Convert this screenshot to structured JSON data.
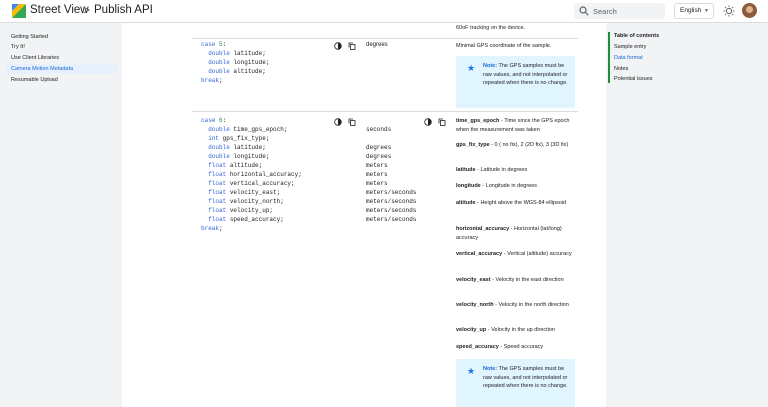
{
  "header": {
    "brand": "Street View",
    "breadcrumb_separator": ">",
    "page": "Publish API",
    "search_placeholder": "Search",
    "language": "English",
    "icons": [
      "street-view-logo-icon",
      "search-icon",
      "brightness-icon",
      "avatar"
    ]
  },
  "sidebar": {
    "items": [
      {
        "label": "Getting Started",
        "active": false
      },
      {
        "label": "Try It!",
        "active": false
      },
      {
        "label": "Use Client Libraries",
        "active": false
      },
      {
        "label": "Camera Motion Metadata",
        "active": true
      },
      {
        "label": "Resumable Upload",
        "active": false
      }
    ]
  },
  "toc": {
    "title": "Table of contents",
    "items": [
      {
        "label": "Sample entry",
        "active": false
      },
      {
        "label": "Data format",
        "active": true
      },
      {
        "label": "Notes",
        "active": false
      },
      {
        "label": "Potential issues",
        "active": false
      }
    ]
  },
  "main": {
    "top_text": "60oF tracking on the device.",
    "case5": {
      "code": [
        "case 5:",
        "  double latitude;",
        "  double longitude;",
        "  double altitude;",
        "break;"
      ],
      "unit": "degrees",
      "desc": "Minimal GPS coordinate of the sample.",
      "note_label": "Note:",
      "note_text": "The GPS samples must be raw values, and not interpolated or repeated when there is no change."
    },
    "case6": {
      "code": [
        "case 6:",
        "  double time_gps_epoch;",
        "  int gps_fix_type;",
        "  double latitude;",
        "  double longitude;",
        "  float altitude;",
        "  float horizontal_accuracy;",
        "  float vertical_accuracy;",
        "  float velocity_east;",
        "  float velocity_north;",
        "  float velocity_up;",
        "  float speed_accuracy;",
        "break;"
      ],
      "units": [
        "seconds",
        "",
        "degrees",
        "degrees",
        "meters",
        "meters",
        "meters",
        "meters/seconds",
        "meters/seconds",
        "meters/seconds",
        "meters/seconds"
      ],
      "fields": [
        {
          "name": "time_gps_epoch",
          "text": " - Time since the GPS epoch when the measurement was taken"
        },
        {
          "name": "gps_fix_type",
          "text": " - 0 ( no fix), 2 (2D fix), 3 (3D fix)"
        },
        {
          "name": "latitude",
          "text": " - Latitude in degrees"
        },
        {
          "name": "longitude",
          "text": " - Longitude in degrees"
        },
        {
          "name": "altitude",
          "text": " - Height above the WGS-84 ellipsoid"
        },
        {
          "name": "horizontal_accuracy",
          "text": " - Horizontal (lat/long) accuracy"
        },
        {
          "name": "vertical_accuracy",
          "text": " - Vertical (altitude) accuracy"
        },
        {
          "name": "velocity_east",
          "text": " - Velocity in the east direction"
        },
        {
          "name": "velocity_north",
          "text": " - Velocity in the north direction"
        },
        {
          "name": "velocity_up",
          "text": " - Velocity in the up direction"
        },
        {
          "name": "speed_accuracy",
          "text": " - Speed accuracy"
        }
      ],
      "note_label": "Note:",
      "note_text": "The GPS samples must be raw values, and not interpolated or repeated when there is no change."
    }
  }
}
